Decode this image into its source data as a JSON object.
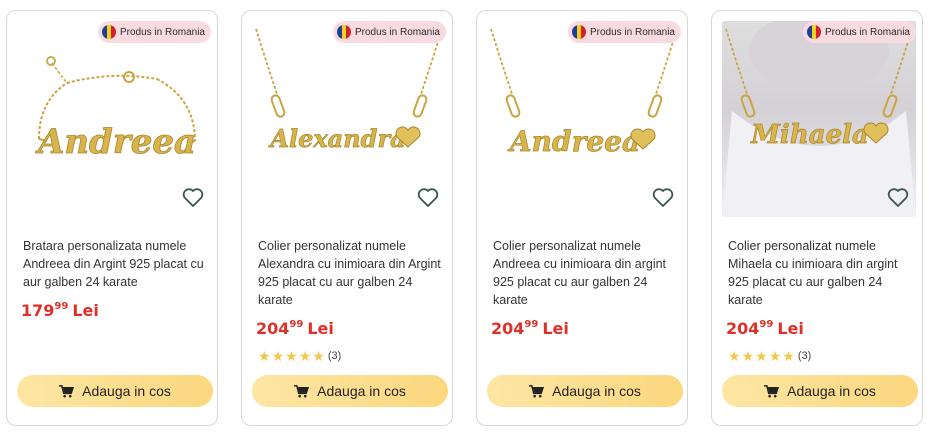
{
  "badge_text": "Produs in Romania",
  "products": [
    {
      "engraving": "Andreea",
      "title": "Bratara personalizata numele Andreea din Argint 925 placat cu aur galben 24 karate",
      "price_int": "179",
      "price_dec": "99",
      "currency": "Lei",
      "rating_count": "",
      "button_label": "Adauga in cos"
    },
    {
      "engraving": "Alexandra",
      "title": "Colier personalizat numele Alexandra cu inimioara din Argint 925 placat cu aur galben 24 karate",
      "price_int": "204",
      "price_dec": "99",
      "currency": "Lei",
      "rating_count": "(3)",
      "button_label": "Adauga in cos"
    },
    {
      "engraving": "Andreea",
      "title": "Colier personalizat numele Andreea cu inimioara din argint 925 placat cu aur galben 24 karate",
      "price_int": "204",
      "price_dec": "99",
      "currency": "Lei",
      "rating_count": "",
      "button_label": "Adauga in cos"
    },
    {
      "engraving": "Mihaela",
      "title": "Colier personalizat numele Mihaela cu inimioara din argint 925 placat cu aur galben 24 karate",
      "price_int": "204",
      "price_dec": "99",
      "currency": "Lei",
      "rating_count": "(3)",
      "button_label": "Adauga in cos"
    }
  ],
  "colors": {
    "price": "#e0302a",
    "button": "#fcd77e",
    "badge": "#f7dbe0",
    "gold": "#d9b44a",
    "star": "#f2c84c"
  }
}
